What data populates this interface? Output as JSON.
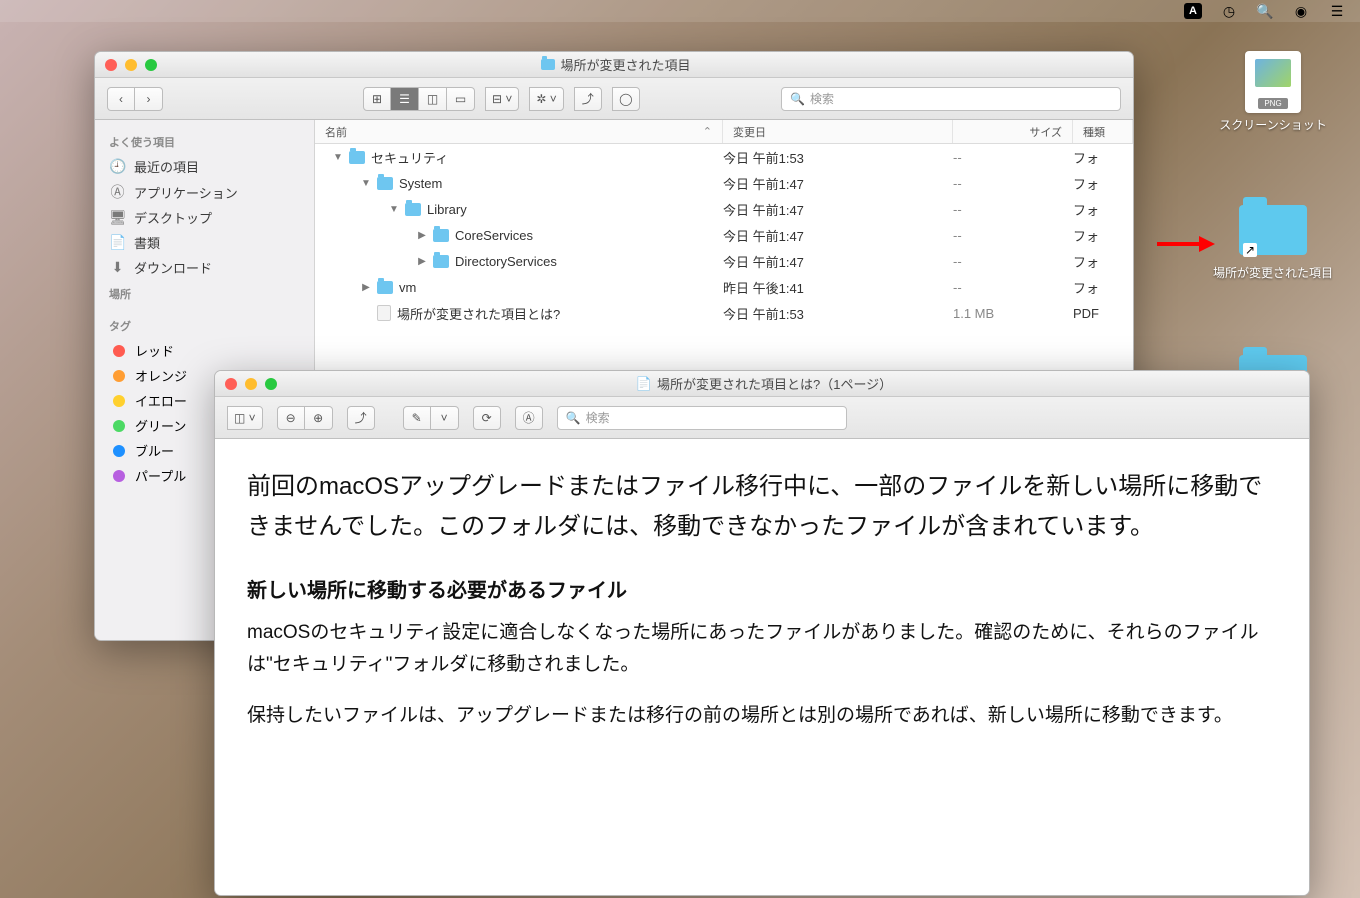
{
  "menubar": {
    "input_badge": "A"
  },
  "desktop": {
    "screenshot_label": "スクリーンショット",
    "png_tag": "PNG",
    "relocated_label": "場所が変更された項目"
  },
  "finder": {
    "title": "場所が変更された項目",
    "search_placeholder": "検索",
    "sidebar": {
      "favorites_header": "よく使う項目",
      "favorites": [
        {
          "icon": "clock",
          "label": "最近の項目"
        },
        {
          "icon": "apps",
          "label": "アプリケーション"
        },
        {
          "icon": "desktop",
          "label": "デスクトップ"
        },
        {
          "icon": "docs",
          "label": "書類"
        },
        {
          "icon": "download",
          "label": "ダウンロード"
        }
      ],
      "locations_header": "場所",
      "tags_header": "タグ",
      "tags": [
        {
          "color": "#ff5b50",
          "label": "レッド"
        },
        {
          "color": "#ff9d33",
          "label": "オレンジ"
        },
        {
          "color": "#ffd02e",
          "label": "イエロー"
        },
        {
          "color": "#4cd964",
          "label": "グリーン"
        },
        {
          "color": "#1e90ff",
          "label": "ブルー"
        },
        {
          "color": "#b75fe0",
          "label": "パープル"
        }
      ]
    },
    "columns": {
      "name": "名前",
      "date": "変更日",
      "size": "サイズ",
      "kind": "種類"
    },
    "rows": [
      {
        "indent": 0,
        "disc": "down",
        "type": "folder",
        "name": "セキュリティ",
        "date": "今日 午前1:53",
        "size": "--",
        "kind": "フォ"
      },
      {
        "indent": 1,
        "disc": "down",
        "type": "folder",
        "name": "System",
        "date": "今日 午前1:47",
        "size": "--",
        "kind": "フォ"
      },
      {
        "indent": 2,
        "disc": "down",
        "type": "folder",
        "name": "Library",
        "date": "今日 午前1:47",
        "size": "--",
        "kind": "フォ"
      },
      {
        "indent": 3,
        "disc": "right",
        "type": "folder",
        "name": "CoreServices",
        "date": "今日 午前1:47",
        "size": "--",
        "kind": "フォ"
      },
      {
        "indent": 3,
        "disc": "right",
        "type": "folder",
        "name": "DirectoryServices",
        "date": "今日 午前1:47",
        "size": "--",
        "kind": "フォ"
      },
      {
        "indent": 1,
        "disc": "right",
        "type": "folder",
        "name": "vm",
        "date": "昨日 午後1:41",
        "size": "--",
        "kind": "フォ"
      },
      {
        "indent": 1,
        "disc": "none",
        "type": "doc",
        "name": "場所が変更された項目とは?",
        "date": "今日 午前1:53",
        "size": "1.1 MB",
        "kind": "PDF"
      }
    ]
  },
  "preview": {
    "title": "場所が変更された項目とは?（1ページ）",
    "search_placeholder": "検索",
    "paragraph1": "前回のmacOSアップグレードまたはファイル移行中に、一部のファイルを新しい場所に移動できませんでした。このフォルダには、移動できなかったファイルが含まれています。",
    "heading": "新しい場所に移動する必要があるファイル",
    "paragraph2": "macOSのセキュリティ設定に適合しなくなった場所にあったファイルがありました。確認のために、それらのファイルは\"セキュリティ\"フォルダに移動されました。",
    "paragraph3": "保持したいファイルは、アップグレードまたは移行の前の場所とは別の場所であれば、新しい場所に移動できます。"
  }
}
